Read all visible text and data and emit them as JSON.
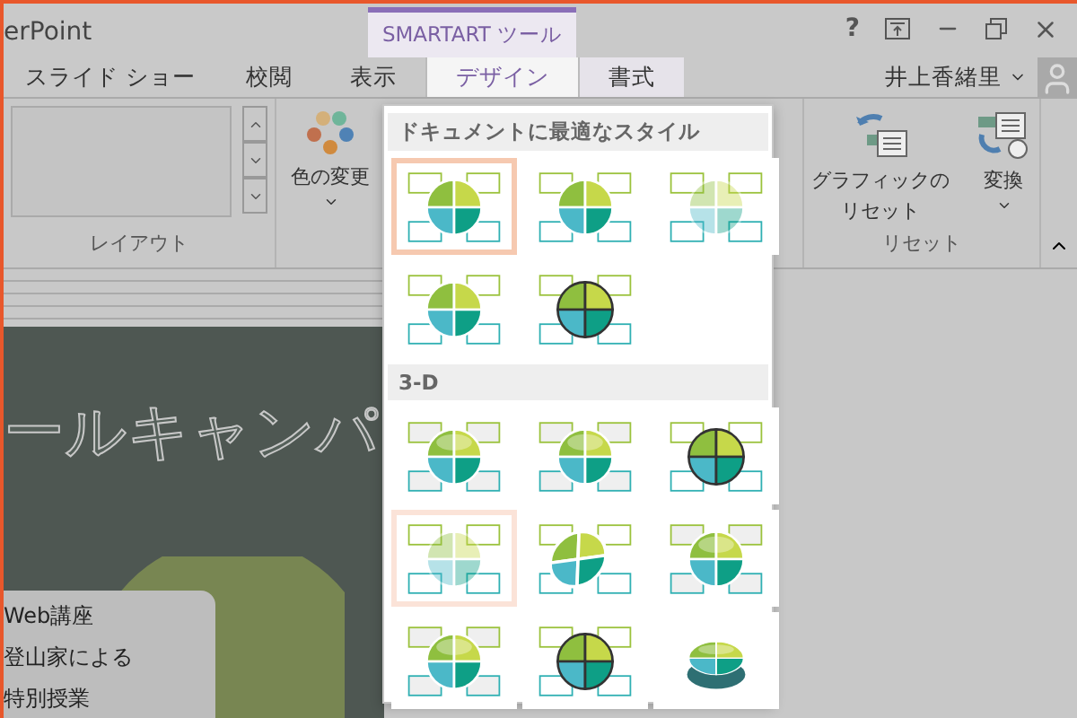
{
  "app": {
    "title": "erPoint"
  },
  "contextual_tab": {
    "label": "SMARTART ツール"
  },
  "help": {
    "label": "?"
  },
  "tabs": [
    {
      "label": "スライド ショー",
      "selected": false,
      "contextual": false
    },
    {
      "label": "校閲",
      "selected": false,
      "contextual": false
    },
    {
      "label": "表示",
      "selected": false,
      "contextual": false
    },
    {
      "label": "デザイン",
      "selected": true,
      "contextual": true
    },
    {
      "label": "書式",
      "selected": false,
      "contextual": true
    }
  ],
  "user": {
    "name": "井上香緒里"
  },
  "layout_group": {
    "label": "レイアウト"
  },
  "color_button": {
    "label": "色の変更"
  },
  "reset_group": {
    "label": "リセット",
    "buttons": [
      {
        "kind": "reset",
        "lines": [
          "グラフィックの",
          "リセット"
        ]
      },
      {
        "kind": "convert",
        "lines": [
          "変換"
        ]
      }
    ]
  },
  "gallery": {
    "sections": [
      {
        "heading": "ドキュメントに最適なスタイル",
        "styles": [
          {
            "kind": "flat",
            "selected": true,
            "hovered": false
          },
          {
            "kind": "flat",
            "selected": false,
            "hovered": false
          },
          {
            "kind": "pale",
            "selected": false,
            "hovered": false
          },
          {
            "kind": "flat",
            "selected": false,
            "hovered": false
          },
          {
            "kind": "outlined",
            "selected": false,
            "hovered": false
          }
        ]
      },
      {
        "heading": "3-D",
        "styles": [
          {
            "kind": "glossy",
            "selected": false,
            "hovered": false
          },
          {
            "kind": "glossy",
            "selected": false,
            "hovered": false
          },
          {
            "kind": "outlined",
            "selected": false,
            "hovered": false
          },
          {
            "kind": "pale",
            "selected": false,
            "hovered": true
          },
          {
            "kind": "tilted",
            "selected": false,
            "hovered": false
          },
          {
            "kind": "glossy",
            "selected": false,
            "hovered": false
          },
          {
            "kind": "glossy",
            "selected": false,
            "hovered": false
          },
          {
            "kind": "outlined",
            "selected": false,
            "hovered": false
          },
          {
            "kind": "pie",
            "selected": false,
            "hovered": false
          }
        ]
      }
    ]
  },
  "slide": {
    "title": "ールキャンパ",
    "box_lines": [
      "Web講座",
      "登山家による",
      "特別授業"
    ]
  }
}
